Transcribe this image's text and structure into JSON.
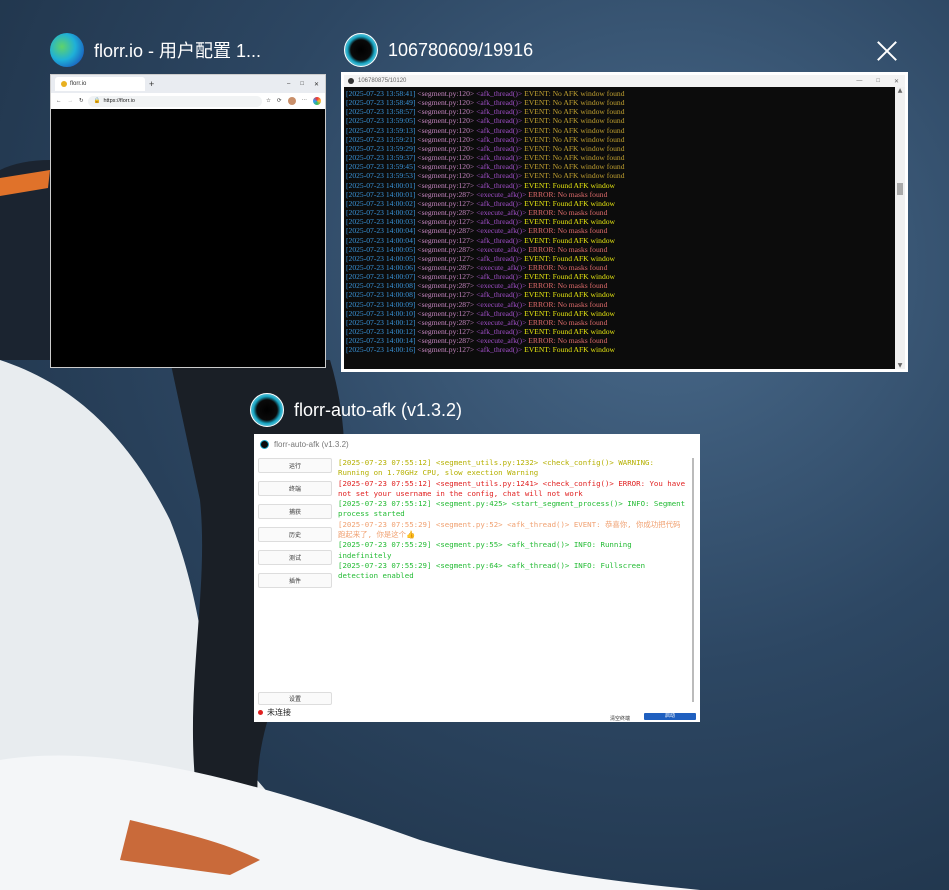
{
  "windows": [
    {
      "title": "florr.io - 用户配置 1...",
      "icon": "edge-icon"
    },
    {
      "title": "106780609/19916",
      "icon": "florr-app-icon"
    },
    {
      "title": "florr-auto-afk (v1.3.2)",
      "icon": "florr-app-icon"
    }
  ],
  "browser": {
    "tab_label": "florr.io",
    "url": "https://florr.io"
  },
  "console": {
    "title": "106780875/10120",
    "lines": [
      {
        "ts": "[2025-07-23 13:58:41]",
        "src": "<segment.py:120>",
        "fn": "<afk_thread()>",
        "msg": "EVENT: No AFK window found",
        "kind": "event"
      },
      {
        "ts": "[2025-07-23 13:58:49]",
        "src": "<segment.py:120>",
        "fn": "<afk_thread()>",
        "msg": "EVENT: No AFK window found",
        "kind": "event"
      },
      {
        "ts": "[2025-07-23 13:58:57]",
        "src": "<segment.py:120>",
        "fn": "<afk_thread()>",
        "msg": "EVENT: No AFK window found",
        "kind": "event"
      },
      {
        "ts": "[2025-07-23 13:59:05]",
        "src": "<segment.py:120>",
        "fn": "<afk_thread()>",
        "msg": "EVENT: No AFK window found",
        "kind": "event"
      },
      {
        "ts": "[2025-07-23 13:59:13]",
        "src": "<segment.py:120>",
        "fn": "<afk_thread()>",
        "msg": "EVENT: No AFK window found",
        "kind": "event"
      },
      {
        "ts": "[2025-07-23 13:59:21]",
        "src": "<segment.py:120>",
        "fn": "<afk_thread()>",
        "msg": "EVENT: No AFK window found",
        "kind": "event"
      },
      {
        "ts": "[2025-07-23 13:59:29]",
        "src": "<segment.py:120>",
        "fn": "<afk_thread()>",
        "msg": "EVENT: No AFK window found",
        "kind": "event"
      },
      {
        "ts": "[2025-07-23 13:59:37]",
        "src": "<segment.py:120>",
        "fn": "<afk_thread()>",
        "msg": "EVENT: No AFK window found",
        "kind": "event"
      },
      {
        "ts": "[2025-07-23 13:59:45]",
        "src": "<segment.py:120>",
        "fn": "<afk_thread()>",
        "msg": "EVENT: No AFK window found",
        "kind": "event"
      },
      {
        "ts": "[2025-07-23 13:59:53]",
        "src": "<segment.py:120>",
        "fn": "<afk_thread()>",
        "msg": "EVENT: No AFK window found",
        "kind": "event"
      },
      {
        "ts": "[2025-07-23 14:00:01]",
        "src": "<segment.py:127>",
        "fn": "<afk_thread()>",
        "msg": "EVENT: Found AFK window",
        "kind": "found"
      },
      {
        "ts": "[2025-07-23 14:00:01]",
        "src": "<segment.py:287>",
        "fn": "<execute_afk()>",
        "msg": "ERROR: No masks found",
        "kind": "error"
      },
      {
        "ts": "[2025-07-23 14:00:02]",
        "src": "<segment.py:127>",
        "fn": "<afk_thread()>",
        "msg": "EVENT: Found AFK window",
        "kind": "found"
      },
      {
        "ts": "[2025-07-23 14:00:02]",
        "src": "<segment.py:287>",
        "fn": "<execute_afk()>",
        "msg": "ERROR: No masks found",
        "kind": "error"
      },
      {
        "ts": "[2025-07-23 14:00:03]",
        "src": "<segment.py:127>",
        "fn": "<afk_thread()>",
        "msg": "EVENT: Found AFK window",
        "kind": "found"
      },
      {
        "ts": "[2025-07-23 14:00:04]",
        "src": "<segment.py:287>",
        "fn": "<execute_afk()>",
        "msg": "ERROR: No masks found",
        "kind": "error"
      },
      {
        "ts": "[2025-07-23 14:00:04]",
        "src": "<segment.py:127>",
        "fn": "<afk_thread()>",
        "msg": "EVENT: Found AFK window",
        "kind": "found"
      },
      {
        "ts": "[2025-07-23 14:00:05]",
        "src": "<segment.py:287>",
        "fn": "<execute_afk()>",
        "msg": "ERROR: No masks found",
        "kind": "error"
      },
      {
        "ts": "[2025-07-23 14:00:05]",
        "src": "<segment.py:127>",
        "fn": "<afk_thread()>",
        "msg": "EVENT: Found AFK window",
        "kind": "found"
      },
      {
        "ts": "[2025-07-23 14:00:06]",
        "src": "<segment.py:287>",
        "fn": "<execute_afk()>",
        "msg": "ERROR: No masks found",
        "kind": "error"
      },
      {
        "ts": "[2025-07-23 14:00:07]",
        "src": "<segment.py:127>",
        "fn": "<afk_thread()>",
        "msg": "EVENT: Found AFK window",
        "kind": "found"
      },
      {
        "ts": "[2025-07-23 14:00:08]",
        "src": "<segment.py:287>",
        "fn": "<execute_afk()>",
        "msg": "ERROR: No masks found",
        "kind": "error"
      },
      {
        "ts": "[2025-07-23 14:00:08]",
        "src": "<segment.py:127>",
        "fn": "<afk_thread()>",
        "msg": "EVENT: Found AFK window",
        "kind": "found"
      },
      {
        "ts": "[2025-07-23 14:00:09]",
        "src": "<segment.py:287>",
        "fn": "<execute_afk()>",
        "msg": "ERROR: No masks found",
        "kind": "error"
      },
      {
        "ts": "[2025-07-23 14:00:10]",
        "src": "<segment.py:127>",
        "fn": "<afk_thread()>",
        "msg": "EVENT: Found AFK window",
        "kind": "found"
      },
      {
        "ts": "[2025-07-23 14:00:12]",
        "src": "<segment.py:287>",
        "fn": "<execute_afk()>",
        "msg": "ERROR: No masks found",
        "kind": "error"
      },
      {
        "ts": "[2025-07-23 14:00:12]",
        "src": "<segment.py:127>",
        "fn": "<afk_thread()>",
        "msg": "EVENT: Found AFK window",
        "kind": "found"
      },
      {
        "ts": "[2025-07-23 14:00:14]",
        "src": "<segment.py:287>",
        "fn": "<execute_afk()>",
        "msg": "ERROR: No masks found",
        "kind": "error"
      },
      {
        "ts": "[2025-07-23 14:00:16]",
        "src": "<segment.py:127>",
        "fn": "<afk_thread()>",
        "msg": "EVENT: Found AFK window",
        "kind": "found"
      }
    ]
  },
  "app": {
    "title": "florr-auto-afk (v1.3.2)",
    "nav": [
      "运行",
      "终端",
      "捕获",
      "历史",
      "测试",
      "插件"
    ],
    "settings_label": "设置",
    "status": "未连接",
    "footer_link": "清空终端",
    "run_button": "启动",
    "log": [
      {
        "text": "[2025-07-23 07:55:12] <segment_utils.py:1232> <check_config()> WARNING: Running on 1.70GHz CPU, slow exection Warning",
        "kind": "warning"
      },
      {
        "text": "[2025-07-23 07:55:12] <segment_utils.py:1241> <check_config()> ERROR: You have not set your username in the config, chat will not work",
        "kind": "error"
      },
      {
        "text": "[2025-07-23 07:55:12] <segment.py:425> <start_segment_process()> INFO: Segment process started",
        "kind": "info"
      },
      {
        "text": "[2025-07-23 07:55:29] <segment.py:52> <afk_thread()> EVENT: 恭喜你, 你成功把代码跑起来了, 你是这个👍",
        "kind": "event"
      },
      {
        "text": "[2025-07-23 07:55:29] <segment.py:55> <afk_thread()> INFO: Running indefinitely",
        "kind": "info"
      },
      {
        "text": "[2025-07-23 07:55:29] <segment.py:64> <afk_thread()> INFO: Fullscreen detection enabled",
        "kind": "info"
      }
    ]
  },
  "colors": {
    "console_ts": "#3a96dd",
    "console_src": "#c586c0",
    "console_fn": "#a04fc8",
    "console_event": "#c0a030",
    "console_found": "#e5e510",
    "console_error": "#e06c6c",
    "app_warning": "#b5b000",
    "app_error": "#e02020",
    "app_info": "#22bb33",
    "app_event": "#f0a070",
    "accent": "#1f5fbf"
  }
}
